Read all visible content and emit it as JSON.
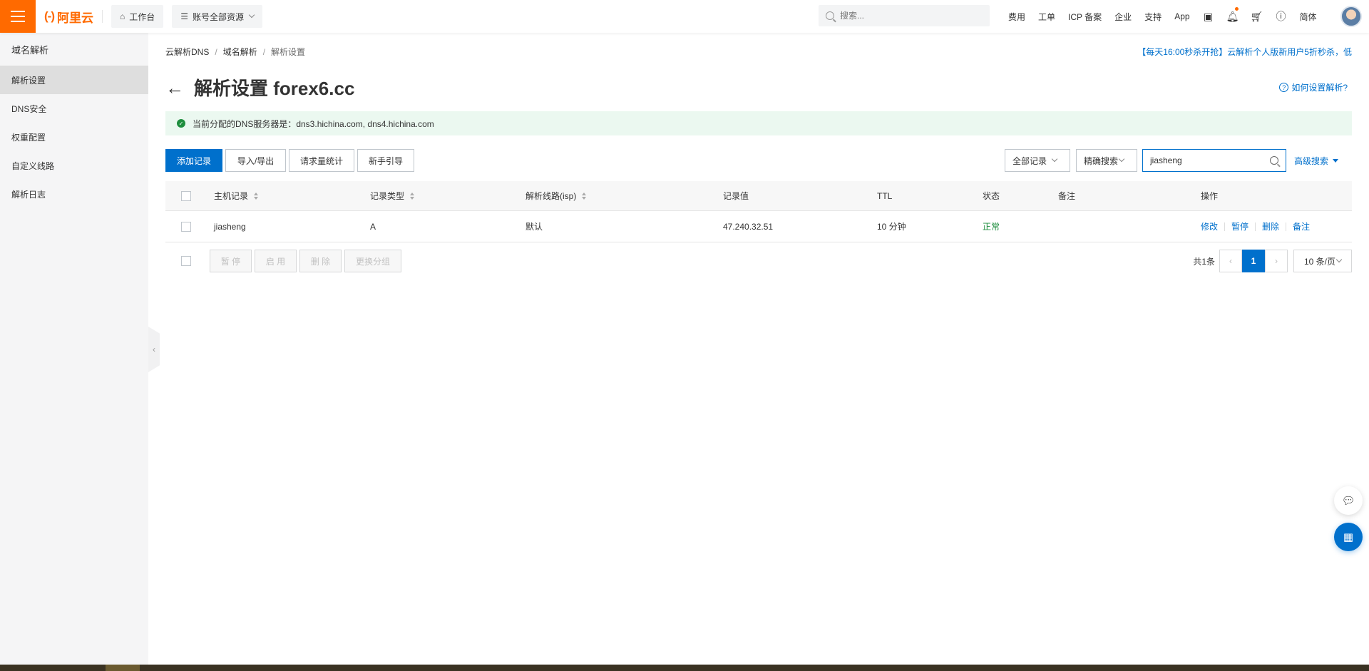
{
  "topbar": {
    "logo_text": "阿里云",
    "workbench": "工作台",
    "resources": "账号全部资源",
    "search_placeholder": "搜索...",
    "links": [
      "费用",
      "工单",
      "ICP 备案",
      "企业",
      "支持",
      "App"
    ],
    "lang": "简体"
  },
  "sidebar": {
    "title": "域名解析",
    "items": [
      "解析设置",
      "DNS安全",
      "权重配置",
      "自定义线路",
      "解析日志"
    ],
    "active_index": 0
  },
  "breadcrumb": [
    "云解析DNS",
    "域名解析",
    "解析设置"
  ],
  "promo": "【每天16:00秒杀开抢】云解析个人版新用户5折秒杀，低",
  "page_title": "解析设置 forex6.cc",
  "help_link": "如何设置解析?",
  "notice": "当前分配的DNS服务器是：dns3.hichina.com, dns4.hichina.com",
  "toolbar": {
    "add_record": "添加记录",
    "import_export": "导入/导出",
    "request_stats": "请求量统计",
    "guide": "新手引导",
    "record_filter": "全部记录",
    "search_mode": "精确搜索",
    "search_value": "jiasheng",
    "advanced_search": "高级搜索"
  },
  "table": {
    "columns": [
      "主机记录",
      "记录类型",
      "解析线路(isp)",
      "记录值",
      "TTL",
      "状态",
      "备注",
      "操作"
    ],
    "rows": [
      {
        "host": "jiasheng",
        "type": "A",
        "line": "默认",
        "value": "47.240.32.51",
        "ttl": "10 分钟",
        "status": "正常",
        "remark": "",
        "actions": [
          "修改",
          "暂停",
          "删除",
          "备注"
        ]
      }
    ]
  },
  "bulk": {
    "pause": "暂 停",
    "enable": "启 用",
    "delete": "删 除",
    "change_group": "更换分组"
  },
  "pagination": {
    "total": "共1条",
    "current": "1",
    "page_size": "10 条/页"
  },
  "colors": {
    "brand": "#ff6a00",
    "primary": "#0070cc",
    "success": "#1e8e3e"
  }
}
